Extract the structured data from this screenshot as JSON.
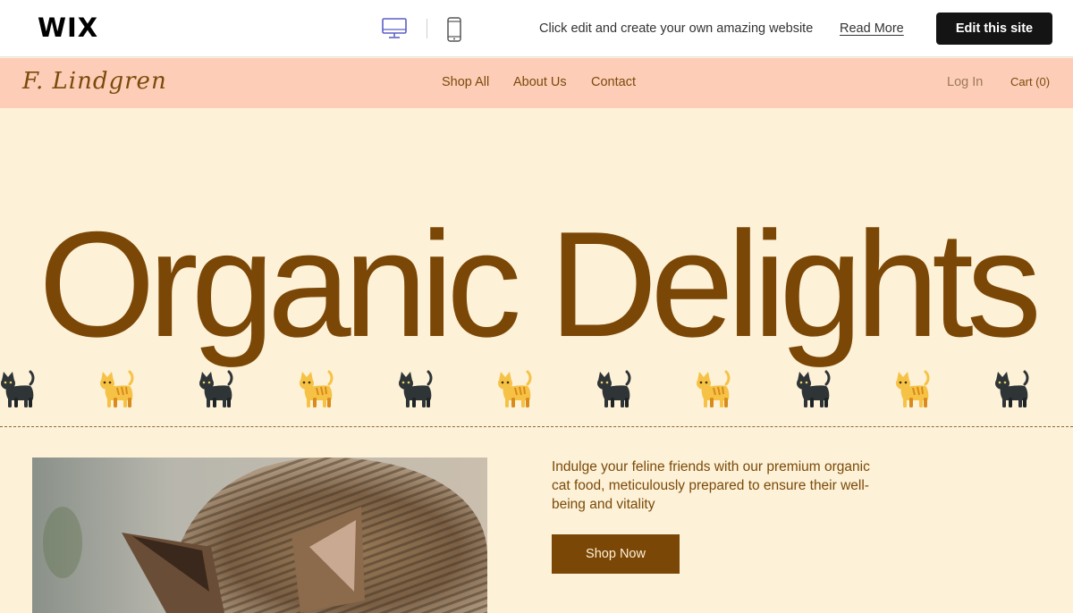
{
  "wix_bar": {
    "logo": "WIX",
    "promo_text": "Click edit and create your own amazing website",
    "read_more": "Read More",
    "edit_button": "Edit this site",
    "icons": [
      "desktop-icon",
      "mobile-icon"
    ]
  },
  "site": {
    "brand": "F. Lindgren",
    "nav": [
      "Shop All",
      "About Us",
      "Contact"
    ],
    "login": "Log In",
    "cart": "Cart (0)",
    "accent_color": "#7b4706",
    "header_color": "#fdcdb8",
    "background_color": "#fdf1d7"
  },
  "hero": {
    "title": "Organic Delights",
    "cat_icons": [
      "black-cat-icon",
      "orange-cat-icon",
      "black-cat-icon",
      "orange-cat-icon",
      "black-cat-icon",
      "orange-cat-icon",
      "black-cat-icon",
      "orange-cat-icon",
      "black-cat-icon",
      "orange-cat-icon",
      "black-cat-icon"
    ]
  },
  "content": {
    "intro": "Indulge your feline friends with our premium organic cat food, meticulously prepared to ensure their well-being and vitality",
    "cta": "Shop Now",
    "image": "tabby-cat-photo"
  }
}
